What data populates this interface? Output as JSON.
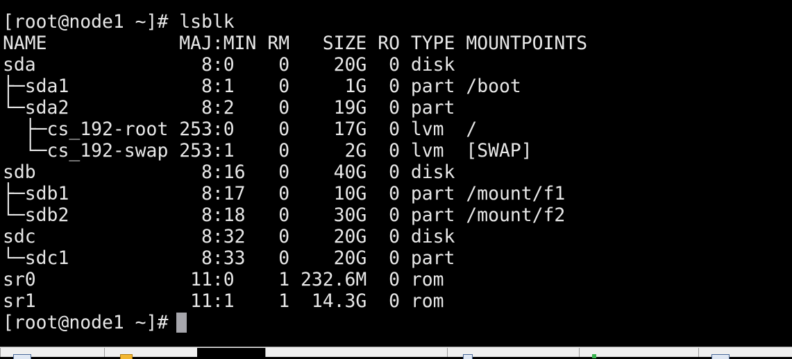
{
  "terminal": {
    "lines": [
      "[root@node1 ~]# lsblk",
      "NAME            MAJ:MIN RM   SIZE RO TYPE MOUNTPOINTS",
      "sda               8:0    0    20G  0 disk",
      "├─sda1            8:1    0     1G  0 part /boot",
      "└─sda2            8:2    0    19G  0 part",
      "  ├─cs_192-root 253:0    0    17G  0 lvm  /",
      "  └─cs_192-swap 253:1    0     2G  0 lvm  [SWAP]",
      "sdb               8:16   0    40G  0 disk",
      "├─sdb1            8:17   0    10G  0 part /mount/f1",
      "└─sdb2            8:18   0    30G  0 part /mount/f2",
      "sdc               8:32   0    20G  0 disk",
      "└─sdc1            8:33   0    20G  0 part",
      "sr0              11:0    1 232.6M  0 rom",
      "sr1              11:1    1  14.3G  0 rom"
    ],
    "prompt": "[root@node1 ~]#"
  },
  "taskbar": {
    "icons": [
      "window-icon",
      "app-icon",
      "arrow-icon",
      "green-icon",
      "window-icon"
    ]
  },
  "colors": {
    "background": "#000000",
    "text": "#e8e8e8",
    "cursor": "#a6a6ac",
    "taskbar": "#ececec"
  }
}
